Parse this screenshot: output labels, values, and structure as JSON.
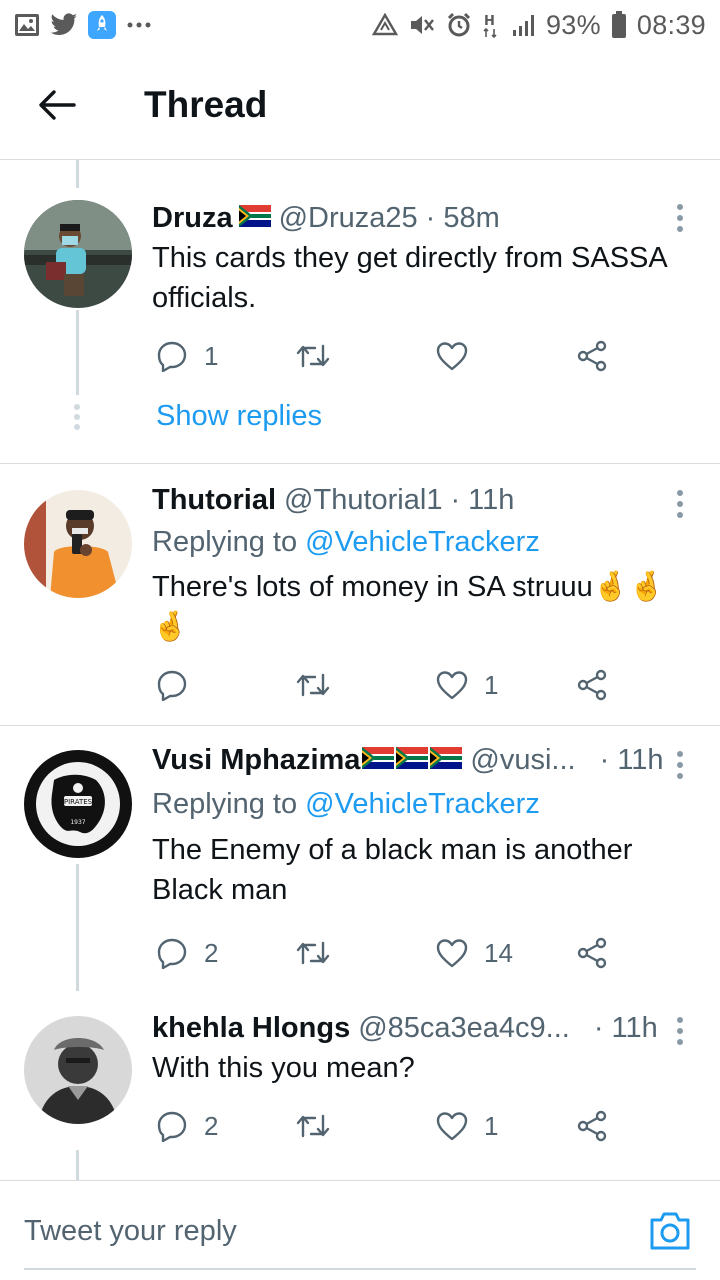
{
  "status_bar": {
    "left_icons": [
      "gallery-icon",
      "twitter-bird-icon",
      "rocket-app-icon",
      "more-notifications-icon"
    ],
    "right_icons": [
      "data-saver-icon",
      "mute-icon",
      "alarm-icon",
      "hplus-network-icon",
      "signal-icon",
      "battery-icon"
    ],
    "battery": "93%",
    "time": "08:39",
    "network": "H"
  },
  "header": {
    "title": "Thread",
    "back_icon": "arrow-left-icon"
  },
  "accent_color": "#1d9bf0",
  "tweets": [
    {
      "name": "Druza",
      "flag": "south-africa-flag",
      "handle": "@Druza25",
      "time": "· 58m",
      "replying_prefix": "",
      "replying_to": "",
      "text": "This cards they get directly from SASSA officials.",
      "reply_count": "1",
      "retweet_count": "",
      "like_count": "",
      "show_replies": "Show replies"
    },
    {
      "name": "Thutorial",
      "flag": "",
      "handle": "@Thutorial1",
      "time": "· 11h",
      "replying_prefix": "Replying to",
      "replying_to": "@VehicleTrackerz",
      "text": "There's lots of money in SA struuu🤞🤞🤞",
      "reply_count": "",
      "retweet_count": "",
      "like_count": "1"
    },
    {
      "name": "Vusi Mphazima",
      "flag": "south-africa-flag x3",
      "handle": "@vusi...",
      "time": "· 11h",
      "replying_prefix": "Replying to",
      "replying_to": "@VehicleTrackerz",
      "text": "The Enemy of a black man is another Black man",
      "reply_count": "2",
      "retweet_count": "",
      "like_count": "14"
    },
    {
      "name": "khehla Hlongs",
      "flag": "",
      "handle": "@85ca3ea4c9...",
      "time": "· 11h",
      "replying_prefix": "",
      "replying_to": "",
      "text": "With this you mean?",
      "reply_count": "2",
      "retweet_count": "",
      "like_count": "1"
    }
  ],
  "composer": {
    "placeholder": "Tweet your reply",
    "camera_icon": "camera-icon"
  }
}
